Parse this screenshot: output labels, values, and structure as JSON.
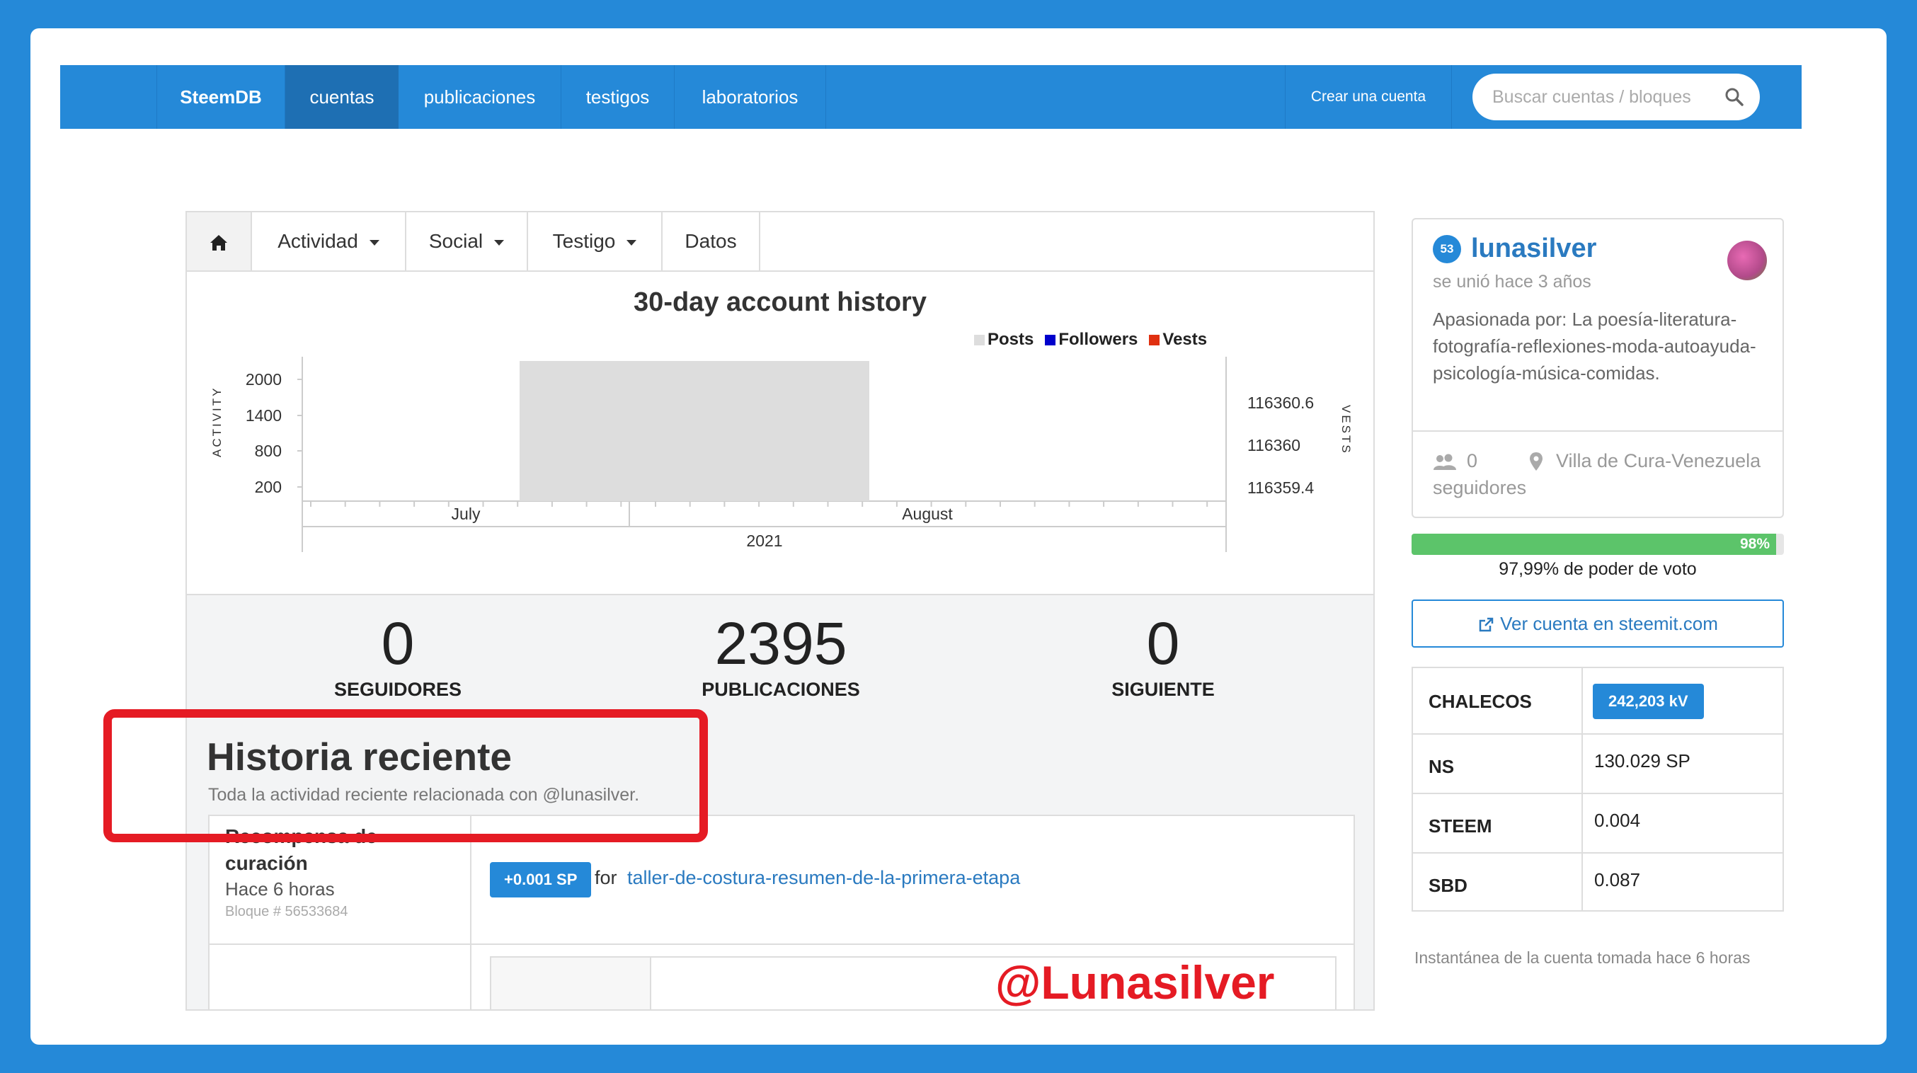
{
  "nav": {
    "brand": "SteemDB",
    "items": [
      "cuentas",
      "publicaciones",
      "testigos",
      "laboratorios"
    ],
    "create_account": "Crear una cuenta",
    "search_placeholder": "Buscar cuentas / bloques"
  },
  "tabs": {
    "activity": "Actividad",
    "social": "Social",
    "witness": "Testigo",
    "data": "Datos"
  },
  "chart_data": {
    "type": "bar",
    "title": "30-day account history",
    "legend": [
      "Posts",
      "Followers",
      "Vests"
    ],
    "legend_colors": [
      "#dddddd",
      "#0000cc",
      "#e03010"
    ],
    "ylabel_left": "ACTIVITY",
    "ylabel_right": "VESTS",
    "y_ticks_left": [
      "2000",
      "1400",
      "800",
      "200"
    ],
    "y_ticks_right": [
      "116360.6",
      "116360",
      "116359.4"
    ],
    "x_ticks": [
      "July",
      "August"
    ],
    "x_year": "2021",
    "series": [
      {
        "name": "Posts",
        "values": [
          2395
        ]
      }
    ]
  },
  "stats": [
    {
      "value": "0",
      "label": "SEGUIDORES"
    },
    {
      "value": "2395",
      "label": "PUBLICACIONES"
    },
    {
      "value": "0",
      "label": "SIGUIENTE"
    }
  ],
  "history": {
    "title": "Historia reciente",
    "subtitle": "Toda la actividad reciente relacionada con @lunasilver.",
    "item": {
      "type": "Recompensa de curación",
      "time": "Hace 6 horas",
      "block": "Bloque # 56533684",
      "amount": "+0.001 SP",
      "for_label": "for",
      "link": "taller-de-costura-resumen-de-la-primera-etapa"
    }
  },
  "watermark": "@Lunasilver",
  "profile": {
    "reputation": "53",
    "name": "lunasilver",
    "joined": "se unió hace 3 años",
    "bio": "Apasionada por: La poesía-literatura-fotografía-reflexiones-moda-autoayuda-psicología-música-comidas.",
    "followers_count": "0",
    "followers_label": "seguidores",
    "location": "Villa de Cura-Venezuela"
  },
  "voting_power": {
    "fill_fraction": 0.98,
    "pct_label": "98%",
    "text": "97,99% de poder de voto"
  },
  "steemit_button": "Ver cuenta en steemit.com",
  "wallet": [
    {
      "key": "CHALECOS",
      "value": "242,203 kV"
    },
    {
      "key": "NS",
      "value": "130.029 SP"
    },
    {
      "key": "STEEM",
      "value": "0.004"
    },
    {
      "key": "SBD",
      "value": "0.087"
    }
  ],
  "snapshot": "Instantánea de la cuenta tomada hace 6 horas",
  "colors": {
    "brand": "#2589d8",
    "highlight": "#e51b24",
    "vp_green": "#5cc46a"
  }
}
